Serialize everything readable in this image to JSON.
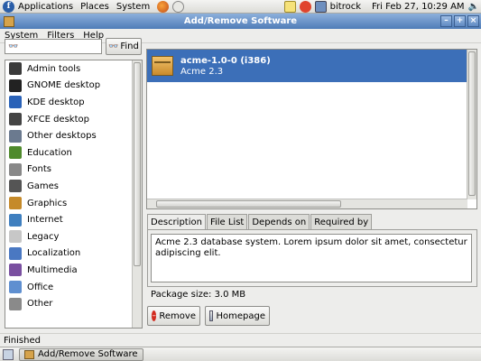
{
  "top_panel": {
    "menus": [
      "Applications",
      "Places",
      "System"
    ],
    "user": "bitrock",
    "clock": "Fri Feb 27, 10:29 AM"
  },
  "window": {
    "title": "Add/Remove Software",
    "menubar": [
      "System",
      "Filters",
      "Help"
    ]
  },
  "search": {
    "value": "",
    "find_label": "Find"
  },
  "categories": [
    {
      "label": "Admin tools",
      "icon": "admin-tools-icon",
      "color": "#3a3a3a"
    },
    {
      "label": "GNOME desktop",
      "icon": "gnome-icon",
      "color": "#222222"
    },
    {
      "label": "KDE desktop",
      "icon": "kde-icon",
      "color": "#2a62b8"
    },
    {
      "label": "XFCE desktop",
      "icon": "xfce-icon",
      "color": "#444444"
    },
    {
      "label": "Other desktops",
      "icon": "desktops-icon",
      "color": "#6b7a8f"
    },
    {
      "label": "Education",
      "icon": "education-icon",
      "color": "#4f8a2c"
    },
    {
      "label": "Fonts",
      "icon": "fonts-icon",
      "color": "#888888"
    },
    {
      "label": "Games",
      "icon": "games-icon",
      "color": "#555555"
    },
    {
      "label": "Graphics",
      "icon": "graphics-icon",
      "color": "#c58a2a"
    },
    {
      "label": "Internet",
      "icon": "internet-icon",
      "color": "#3f7fbf"
    },
    {
      "label": "Legacy",
      "icon": "legacy-icon",
      "color": "#c7c7c7"
    },
    {
      "label": "Localization",
      "icon": "localization-icon",
      "color": "#4a78c2"
    },
    {
      "label": "Multimedia",
      "icon": "multimedia-icon",
      "color": "#7a4fa0"
    },
    {
      "label": "Office",
      "icon": "office-icon",
      "color": "#5f8fd0"
    },
    {
      "label": "Other",
      "icon": "other-icon",
      "color": "#8a8a8a"
    }
  ],
  "packages": [
    {
      "name": "acme-1.0-0 (i386)",
      "summary": "Acme 2.3",
      "selected": true
    }
  ],
  "tabs": [
    {
      "label": "Description",
      "active": true
    },
    {
      "label": "File List",
      "active": false
    },
    {
      "label": "Depends on",
      "active": false
    },
    {
      "label": "Required by",
      "active": false
    }
  ],
  "description": "Acme 2.3 database system.  Lorem ipsum dolor sit amet, consectetur adipiscing elit.",
  "package_size": "Package size:  3.0 MB",
  "buttons": {
    "remove": "Remove",
    "homepage": "Homepage"
  },
  "status": "Finished",
  "taskbar": {
    "task": "Add/Remove Software"
  },
  "colors": {
    "selection": "#3c6fb8",
    "titlebar": "#4f7cb8",
    "remove_red": "#d22b1f"
  }
}
